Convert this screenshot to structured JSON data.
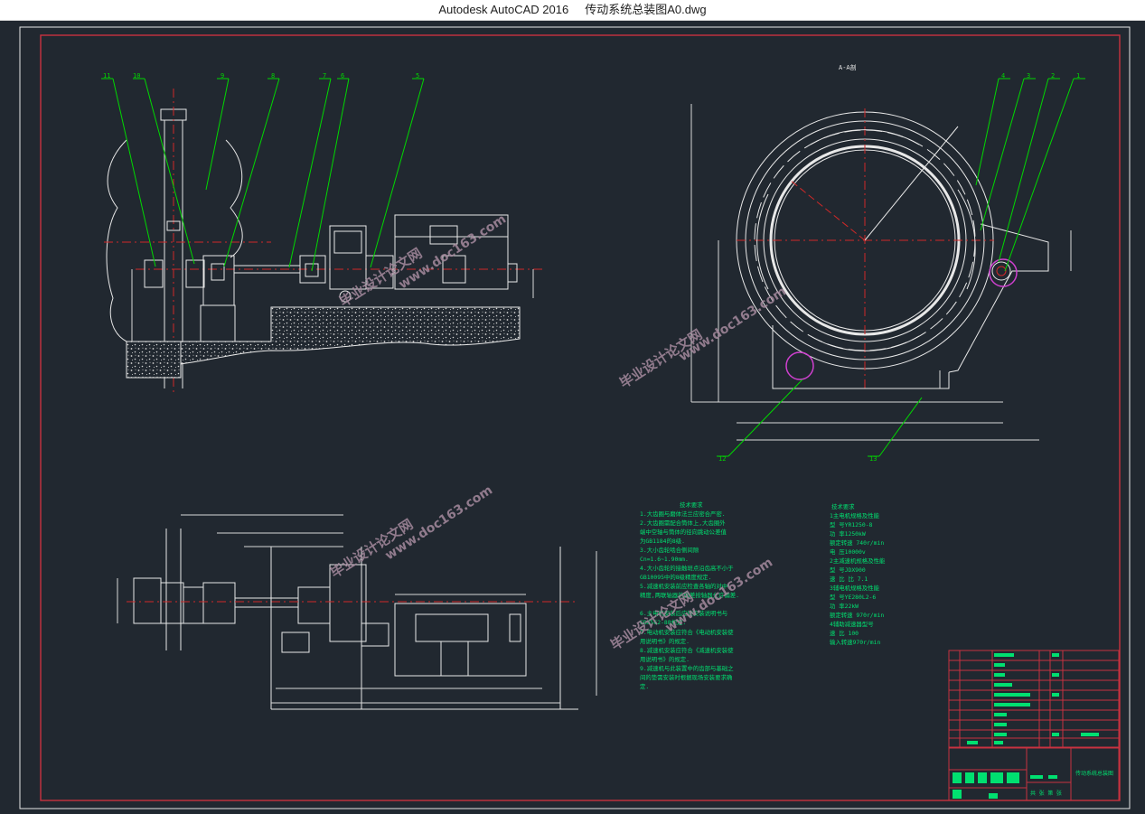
{
  "window": {
    "app_name": "Autodesk AutoCAD 2016",
    "file_name": "传动系统总装图A0.dwg"
  },
  "views": {
    "section_title": "A-A剖"
  },
  "balloons_left": [
    "11",
    "10",
    "9",
    "8",
    "7",
    "6",
    "5"
  ],
  "balloons_right": [
    "4",
    "3",
    "2",
    "1"
  ],
  "balloons_bottom": [
    "12",
    "13"
  ],
  "notes_left": {
    "title": "技术要求",
    "lines": [
      "1.大齿圈与磨体法兰应密合严密.",
      "2.大齿圈需配合筒体上,大齿圈外",
      "端中空轴与筒体的径向跳动公差值",
      "为GB1184的8级.",
      "3.大小齿轮啮合侧间隙",
      "Cn=1.6~1.90mm.",
      "4.大小齿轮的接触斑点沿齿高不小于",
      "GB10095中的8级精度规定.",
      "5.减速机安装前应检查各轴的对中",
      "精度,两联轴器的偏差按轴器允许偏差.",
      "6.主电机安装后应按安装说明书与",
      "GB8562-88规定.",
      "7.电动机安装应符合《电动机安装使",
      "用说明书》的规定.",
      "8.减速机安装应符合《减速机安装使",
      "用说明书》的规定.",
      "9.减速机与此装置中的齿部与基础之",
      "间的垫需安装时根据现场安装要求确",
      "定."
    ]
  },
  "notes_right": {
    "title": "技术要求",
    "lines": [
      "1主电机规格及性能",
      "  型  号YR1250-8",
      "  功  率1250kW",
      "  额定转速 740r/min",
      "  电  压10000v",
      "2主减速机规格及性能",
      "  型  号JDX900",
      "  速  比 比 7.1",
      "3辅电机规格及性能",
      "  型  号YE280L2-6",
      "  功  率22kW",
      "  额定转速 970r/min",
      "4辅助减速器型号",
      "  速  比 100",
      "  输入转速970r/min"
    ]
  },
  "title_block": {
    "drawing_title": "传动系统总装图",
    "scale_row": "共 张 第 张"
  },
  "watermarks": [
    "毕业设计论文网",
    "www.doc163.com"
  ],
  "colors": {
    "background": "#212830",
    "frame": "#c83240",
    "geometry": "#e8e8e8",
    "leader": "#00d800",
    "centerline": "#d02828",
    "dimension": "#d8d8d8",
    "notes": "#00e070",
    "highlight": "#d040d0"
  }
}
